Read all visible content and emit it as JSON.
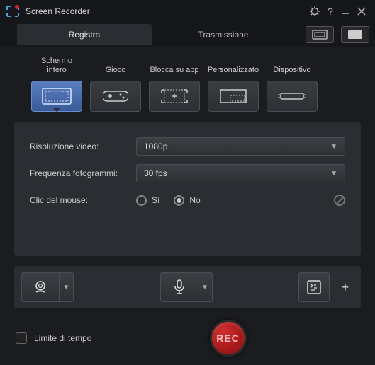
{
  "titlebar": {
    "title": "Screen Recorder"
  },
  "tabs": {
    "record": "Registra",
    "stream": "Trasmissione"
  },
  "modes": {
    "fullscreen": "Schermo intero",
    "game": "Gioco",
    "lockapp": "Blocca su app",
    "custom": "Personalizzato",
    "device": "Dispositivo"
  },
  "settings": {
    "resolution_label": "Risoluzione video:",
    "resolution_value": "1080p",
    "framerate_label": "Frequenza fotogrammi:",
    "framerate_value": "30 fps",
    "mouse_label": "Clic del mouse:",
    "yes": "Sì",
    "no": "No"
  },
  "footer": {
    "timelimit": "Limite di tempo",
    "rec": "REC"
  }
}
